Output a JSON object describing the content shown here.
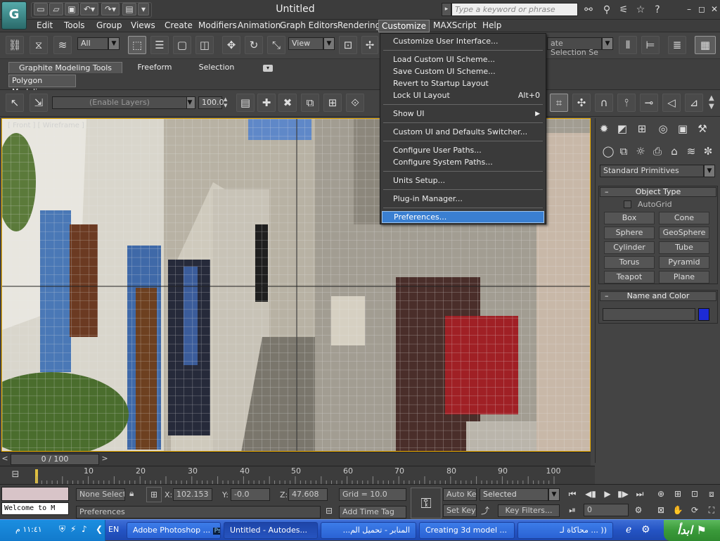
{
  "title_bar": {
    "app_logo_icon": "3ds-max-logo-icon",
    "window_title": "Untitled",
    "search_placeholder": "Type a keyword or phrase",
    "window_controls": [
      "–",
      "◻",
      "✕"
    ]
  },
  "menubar": {
    "items": [
      "Edit",
      "Tools",
      "Group",
      "Views",
      "Create",
      "Modifiers",
      "Animation",
      "Graph Editors",
      "Rendering",
      "Customize",
      "MAXScript",
      "Help"
    ],
    "active": "Customize"
  },
  "toolbar": {
    "selection_filter": "All",
    "reference_coord": "View",
    "named_selection_placeholder": "ate Selection Se"
  },
  "ribbon": {
    "tabs": [
      "Graphite Modeling Tools",
      "Freeform",
      "Selection"
    ],
    "active_tab": "Graphite Modeling Tools",
    "sub_tab": "Polygon Modeling",
    "layers_dropdown": "(Enable Layers)",
    "spinner_value": "100.0"
  },
  "customize_menu": {
    "items": [
      {
        "label": "Customize User Interface...",
        "group": 1
      },
      {
        "label": "Load Custom UI Scheme...",
        "group": 2
      },
      {
        "label": "Save Custom UI Scheme...",
        "group": 2
      },
      {
        "label": "Revert to Startup Layout",
        "group": 2
      },
      {
        "label": "Lock UI Layout",
        "group": 2,
        "shortcut": "Alt+0"
      },
      {
        "label": "Show UI",
        "group": 3,
        "submenu": true
      },
      {
        "label": "Custom UI and Defaults Switcher...",
        "group": 4
      },
      {
        "label": "Configure User Paths...",
        "group": 5
      },
      {
        "label": "Configure System Paths...",
        "group": 5
      },
      {
        "label": "Units Setup...",
        "group": 6
      },
      {
        "label": "Plug-in Manager...",
        "group": 7
      },
      {
        "label": "Preferences...",
        "group": 8,
        "highlighted": true
      }
    ]
  },
  "viewport": {
    "label": "[ Front ] [ Wireframe ]",
    "border_color": "#f0b000"
  },
  "command_panel": {
    "category_dropdown": "Standard Primitives",
    "object_type_title": "Object Type",
    "autogrid_label": "AutoGrid",
    "object_buttons": [
      "Box",
      "Cone",
      "Sphere",
      "GeoSphere",
      "Cylinder",
      "Tube",
      "Torus",
      "Pyramid",
      "Teapot",
      "Plane"
    ],
    "name_color_title": "Name and Color",
    "object_color": "#1d2bd6"
  },
  "time_slider": {
    "label": "0 / 100",
    "ticks": [
      "10",
      "20",
      "30",
      "40",
      "50",
      "60",
      "70",
      "80",
      "90",
      "100"
    ]
  },
  "status": {
    "selection_text": "None Selected",
    "prompt_text": "Preferences",
    "listener_text": "Welcome to M",
    "x_label": "X:",
    "x_value": "102.153",
    "y_label": "Y:",
    "y_value": "-0.0",
    "z_label": "Z:",
    "z_value": "47.608",
    "grid": "Grid = 10.0",
    "add_time_tag": "Add Time Tag",
    "auto_key": "Auto Key",
    "set_key": "Set Key",
    "key_mode": "Selected",
    "key_filters": "Key Filters...",
    "current_frame": "0"
  },
  "taskbar": {
    "start_label": "ابدأ",
    "clock": "١١:٤١ م",
    "language": "EN",
    "tasks": [
      {
        "label": "Adobe Photoshop ...",
        "badge": "Ps"
      },
      {
        "label": "Untitled - Autodes...",
        "active": true
      },
      {
        "label": "المنابر - تحميل الم..."
      },
      {
        "label": "Creating 3d model ..."
      },
      {
        "label": "(( ... محاكاة لـ"
      }
    ]
  }
}
